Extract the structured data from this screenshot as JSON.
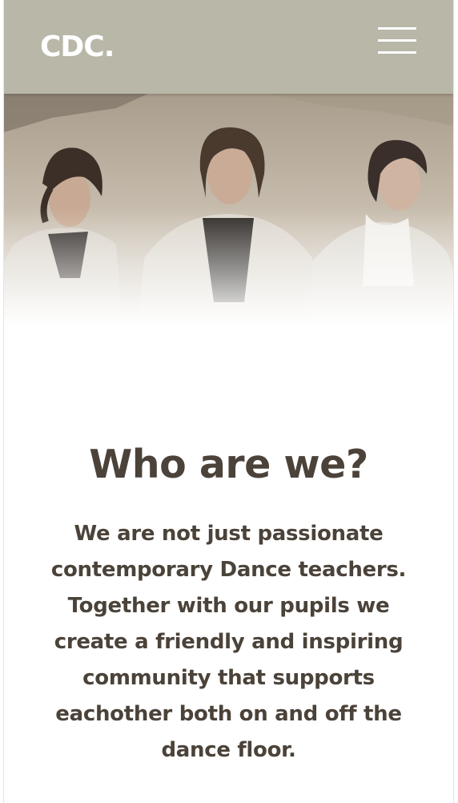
{
  "header": {
    "logo_text": "CDC.",
    "menu_icon": "hamburger-menu-icon",
    "background_color": "#b8b7a8"
  },
  "hero": {
    "image_subject": "three-dancers-photo"
  },
  "about": {
    "heading": "Who are we?",
    "body": "We are not just passionate contemporary Dance teachers. Together with our pupils we create a friendly and inspiring community that supports eachother both on and off the dance floor.",
    "text_color": "#4b4239"
  }
}
